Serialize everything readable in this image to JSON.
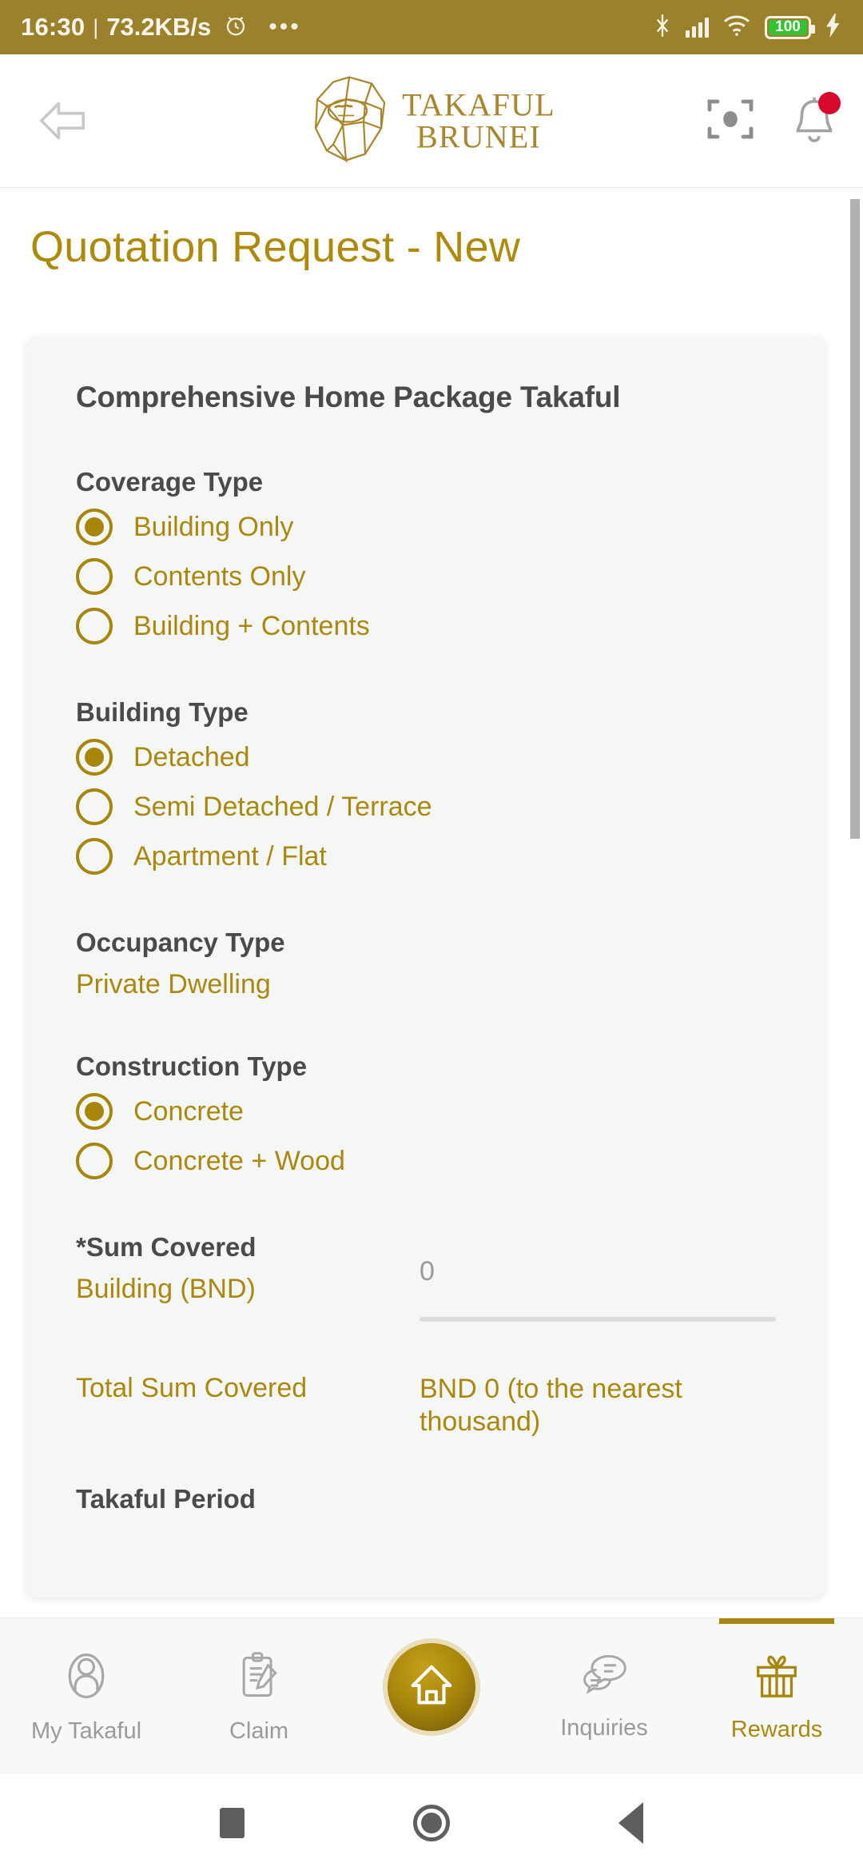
{
  "status_bar": {
    "time": "16:30",
    "separator": "|",
    "network_speed": "73.2KB/s",
    "alarm_icon": "alarm-clock-icon",
    "overflow_icon": "more-dots-icon",
    "bluetooth_icon": "bluetooth-icon",
    "signal_icon": "signal-bars-icon",
    "wifi_icon": "wifi-icon",
    "battery_percent": "100",
    "charging_icon": "charging-bolt-icon",
    "bg_color": "#9c812c"
  },
  "header": {
    "back_icon": "back-arrow-icon",
    "logo_icon": "takaful-brunei-emblem-icon",
    "brand_line1": "TAKAFUL",
    "brand_line2": "BRUNEI",
    "scan_icon": "scan-qr-icon",
    "notification_icon": "bell-icon",
    "notification_badge": true
  },
  "page": {
    "title": "Quotation Request - New",
    "accent_color": "#a8860b",
    "title_color": "#ad8a0c",
    "card_bg": "#f5f7f6"
  },
  "card": {
    "title": "Comprehensive Home Package Takaful",
    "groups": [
      {
        "label": "Coverage Type",
        "name": "coverage-type",
        "options": [
          {
            "label": "Building Only",
            "selected": true
          },
          {
            "label": "Contents Only",
            "selected": false
          },
          {
            "label": "Building + Contents",
            "selected": false
          }
        ]
      },
      {
        "label": "Building Type",
        "name": "building-type",
        "options": [
          {
            "label": "Detached",
            "selected": true
          },
          {
            "label": "Semi Detached / Terrace",
            "selected": false
          },
          {
            "label": "Apartment / Flat",
            "selected": false
          }
        ]
      }
    ],
    "occupancy": {
      "label": "Occupancy Type",
      "value": "Private Dwelling"
    },
    "construction": {
      "label": "Construction Type",
      "name": "construction-type",
      "options": [
        {
          "label": "Concrete",
          "selected": true
        },
        {
          "label": "Concrete + Wood",
          "selected": false
        }
      ]
    },
    "sum_covered": {
      "label": "*Sum Covered",
      "field_label": "Building (BND)",
      "field_value": "",
      "field_placeholder": "0"
    },
    "total_sum": {
      "label": "Total Sum Covered",
      "value": "BND 0 (to the nearest thousand)"
    },
    "cut_off_text": "Takaful Period"
  },
  "bottom_nav": {
    "items": [
      {
        "label": "My Takaful",
        "icon": "user-profile-icon",
        "active": false
      },
      {
        "label": "Claim",
        "icon": "clipboard-pen-icon",
        "active": false
      },
      {
        "label": "",
        "icon": "home-icon",
        "active": false,
        "is_home": true
      },
      {
        "label": "Inquiries",
        "icon": "chat-bubbles-icon",
        "active": false
      },
      {
        "label": "Rewards",
        "icon": "gift-box-icon",
        "active": true
      }
    ]
  },
  "system_nav": {
    "recents_icon": "square-recents-icon",
    "home_icon": "circle-home-icon",
    "back_icon": "triangle-back-icon"
  }
}
